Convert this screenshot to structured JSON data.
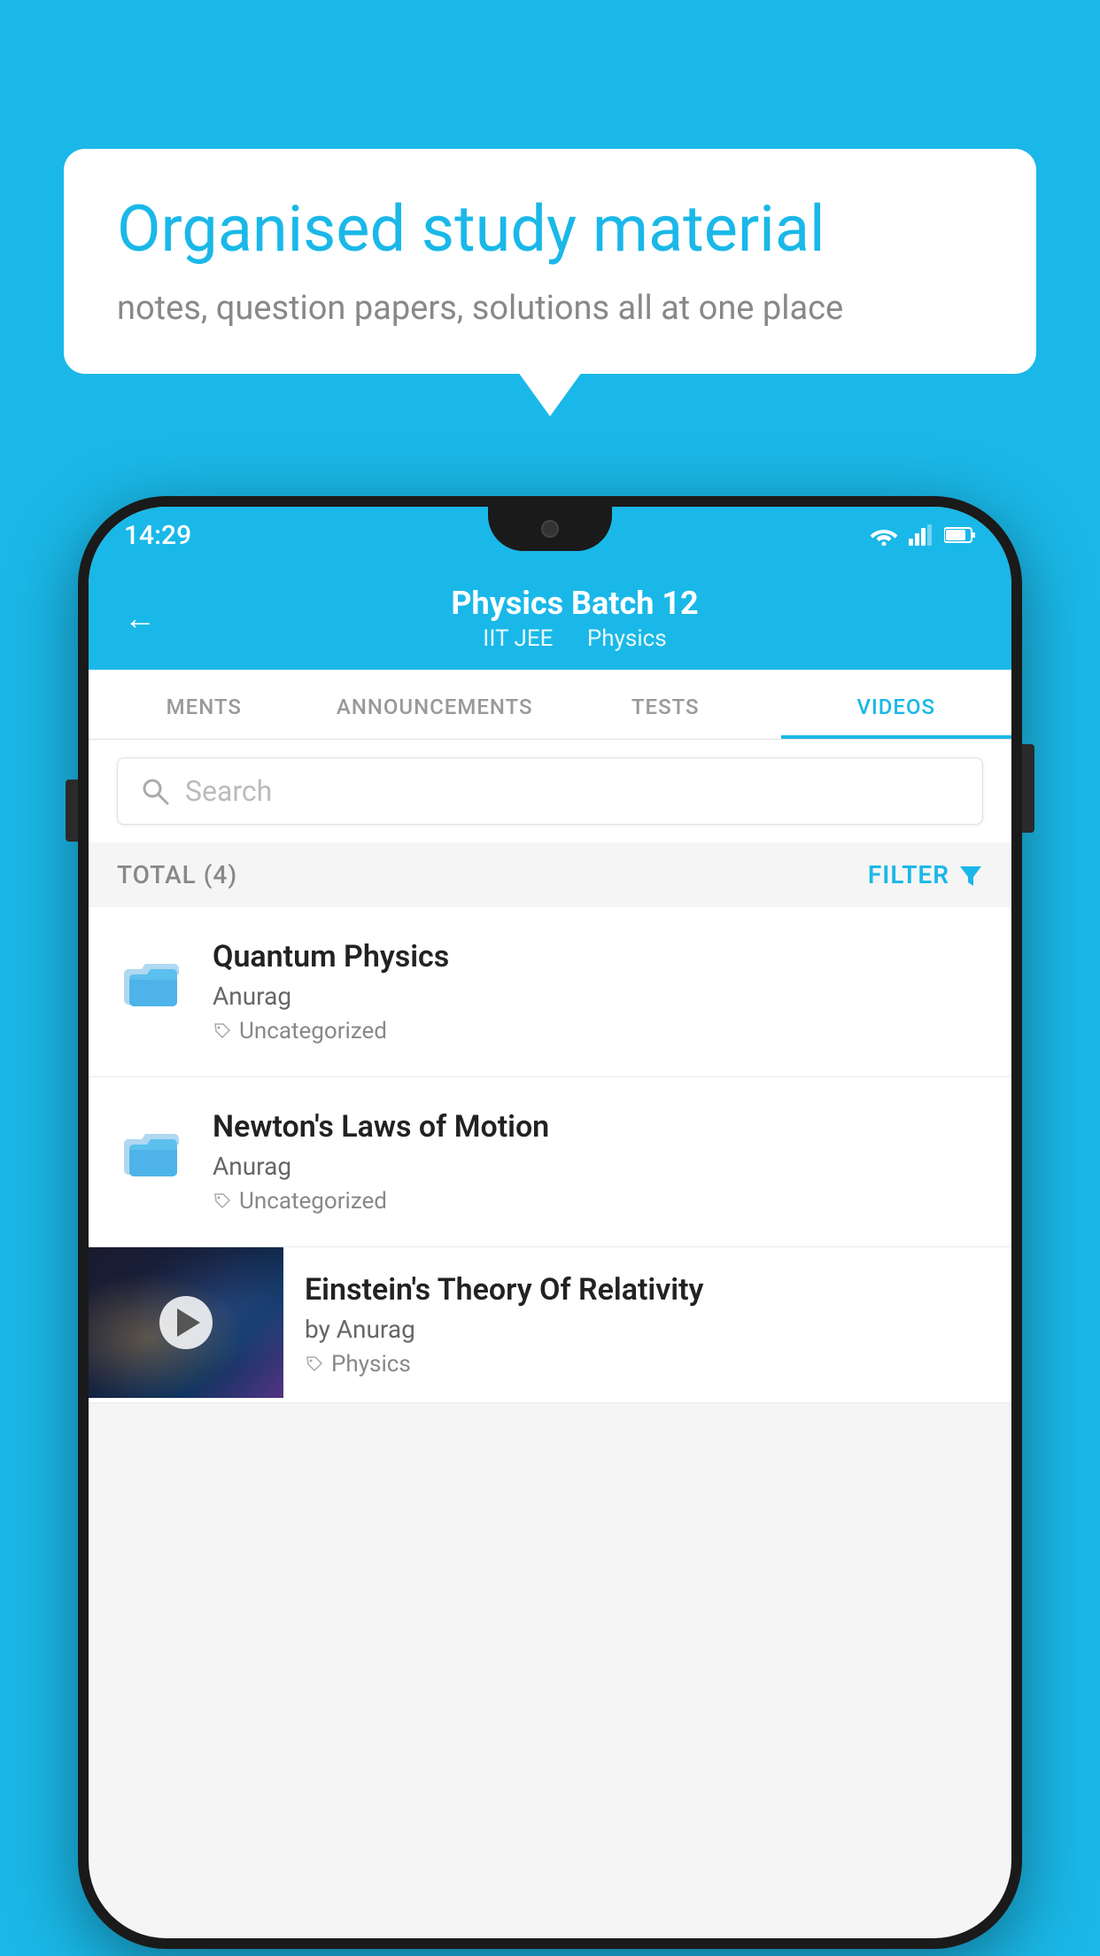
{
  "background_color": "#1ab8e8",
  "bubble": {
    "title": "Organised study material",
    "subtitle": "notes, question papers, solutions all at one place"
  },
  "phone": {
    "status_bar": {
      "time": "14:29",
      "icons": [
        "wifi",
        "signal",
        "battery"
      ]
    },
    "header": {
      "back_label": "←",
      "title": "Physics Batch 12",
      "subtitle_part1": "IIT JEE",
      "subtitle_part2": "Physics"
    },
    "tabs": [
      {
        "label": "MENTS",
        "active": false
      },
      {
        "label": "ANNOUNCEMENTS",
        "active": false
      },
      {
        "label": "TESTS",
        "active": false
      },
      {
        "label": "VIDEOS",
        "active": true
      }
    ],
    "search": {
      "placeholder": "Search"
    },
    "filter_bar": {
      "total_label": "TOTAL (4)",
      "filter_label": "FILTER"
    },
    "list_items": [
      {
        "type": "folder",
        "title": "Quantum Physics",
        "author": "Anurag",
        "tag": "Uncategorized"
      },
      {
        "type": "folder",
        "title": "Newton's Laws of Motion",
        "author": "Anurag",
        "tag": "Uncategorized"
      },
      {
        "type": "video",
        "title": "Einstein's Theory Of Relativity",
        "author": "by Anurag",
        "tag": "Physics"
      }
    ]
  }
}
